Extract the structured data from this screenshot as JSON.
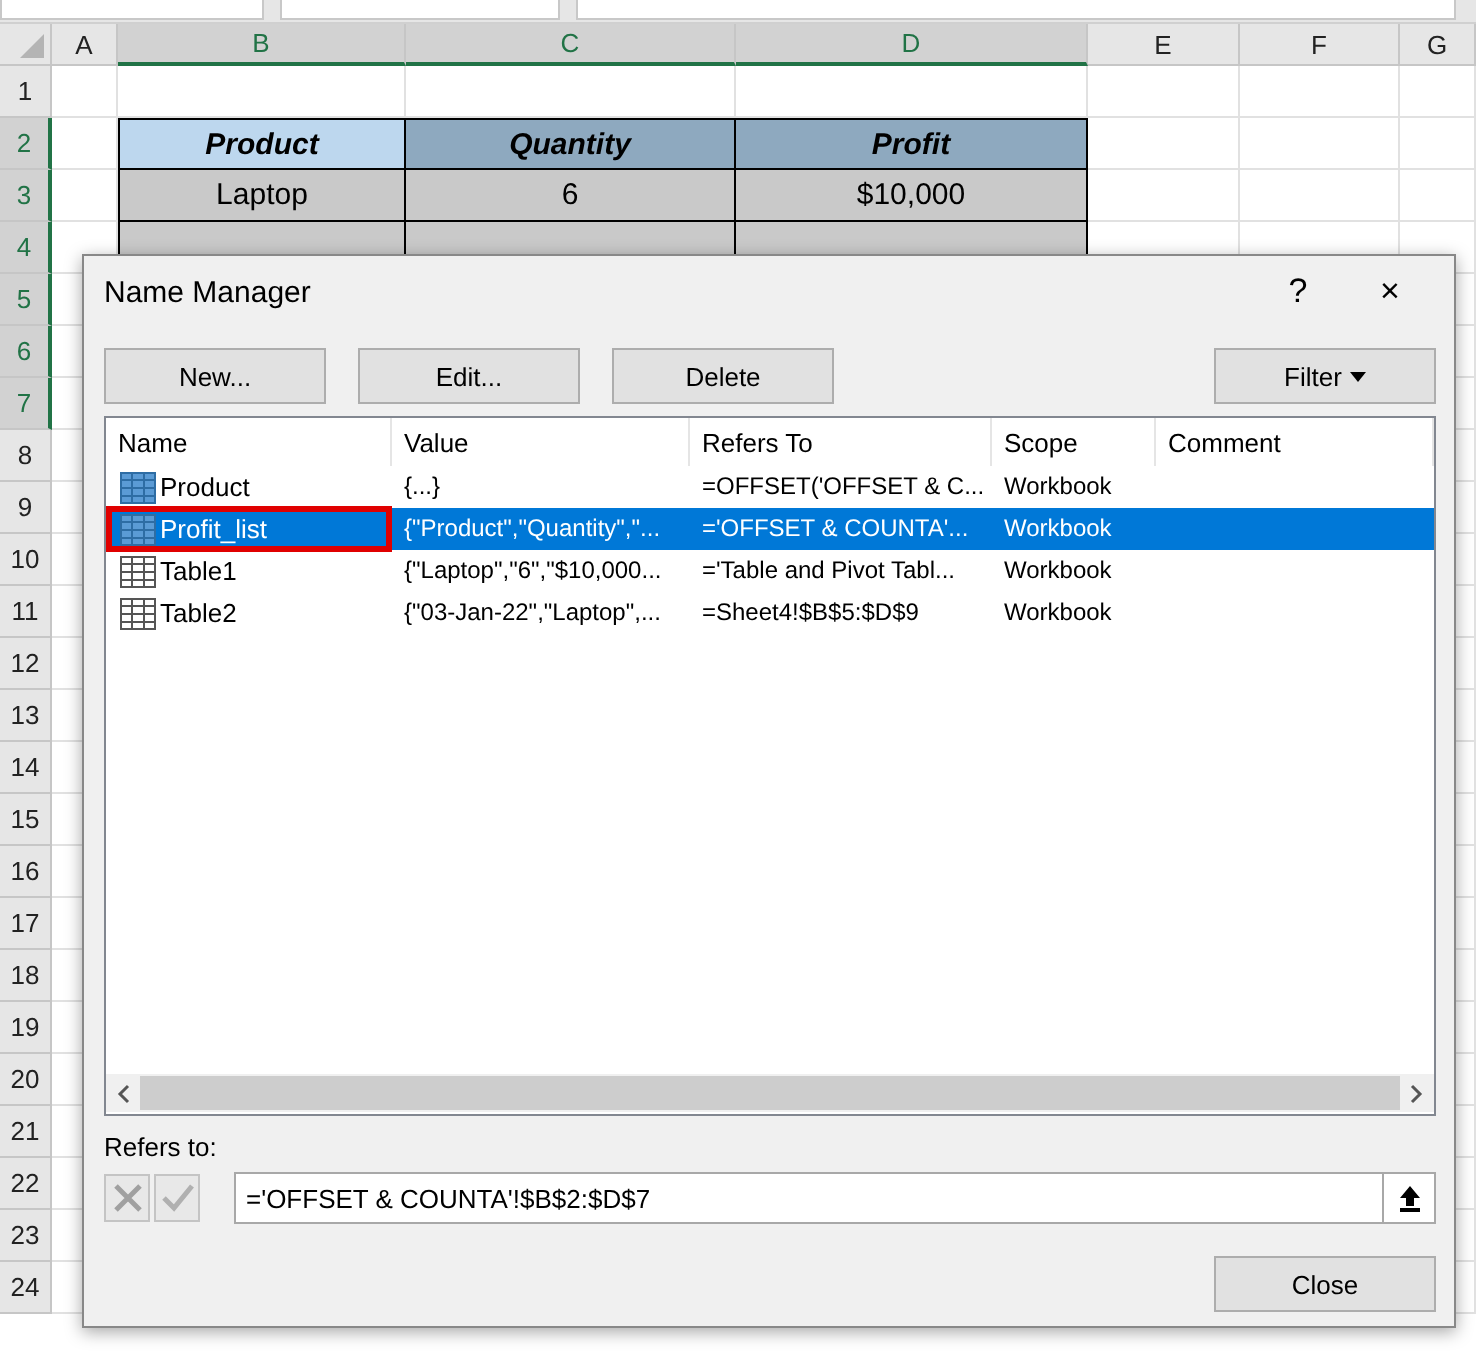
{
  "sheet": {
    "columns": [
      {
        "label": "A",
        "selected": false
      },
      {
        "label": "B",
        "selected": true
      },
      {
        "label": "C",
        "selected": true
      },
      {
        "label": "D",
        "selected": true
      },
      {
        "label": "E",
        "selected": false
      },
      {
        "label": "F",
        "selected": false
      },
      {
        "label": "G",
        "selected": false
      }
    ],
    "rows": [
      {
        "label": "1",
        "selected": false
      },
      {
        "label": "2",
        "selected": true
      },
      {
        "label": "3",
        "selected": true
      },
      {
        "label": "4",
        "selected": true
      },
      {
        "label": "5",
        "selected": true
      },
      {
        "label": "6",
        "selected": true
      },
      {
        "label": "7",
        "selected": true
      },
      {
        "label": "8",
        "selected": false
      },
      {
        "label": "9",
        "selected": false
      },
      {
        "label": "10",
        "selected": false
      },
      {
        "label": "11",
        "selected": false
      },
      {
        "label": "12",
        "selected": false
      },
      {
        "label": "13",
        "selected": false
      },
      {
        "label": "14",
        "selected": false
      },
      {
        "label": "15",
        "selected": false
      },
      {
        "label": "16",
        "selected": false
      },
      {
        "label": "17",
        "selected": false
      },
      {
        "label": "18",
        "selected": false
      },
      {
        "label": "19",
        "selected": false
      },
      {
        "label": "20",
        "selected": false
      },
      {
        "label": "21",
        "selected": false
      },
      {
        "label": "22",
        "selected": false
      },
      {
        "label": "23",
        "selected": false
      },
      {
        "label": "24",
        "selected": false
      }
    ],
    "table": {
      "header": [
        {
          "text": "Product",
          "active": true
        },
        {
          "text": "Quantity",
          "active": false
        },
        {
          "text": "Profit",
          "active": false
        }
      ],
      "rows": [
        [
          "Laptop",
          "6",
          "$10,000"
        ]
      ]
    }
  },
  "dialog": {
    "title": "Name Manager",
    "help": "?",
    "close": "×",
    "buttons": [
      {
        "label": "New...",
        "disabled": false
      },
      {
        "label": "Edit...",
        "disabled": false
      },
      {
        "label": "Delete",
        "disabled": false
      }
    ],
    "filter": "Filter",
    "columns": [
      "Name",
      "Value",
      "Refers To",
      "Scope",
      "Comment"
    ],
    "names": [
      {
        "kind": "range",
        "name": "Product",
        "value": "{...}",
        "refers_to": "=OFFSET('OFFSET & C...",
        "scope": "Workbook",
        "selected": false,
        "outlined": false
      },
      {
        "kind": "range",
        "name": "Profit_list",
        "value": "{\"Product\",\"Quantity\",\"...",
        "refers_to": "='OFFSET & COUNTA'...",
        "scope": "Workbook",
        "selected": true,
        "outlined": true
      },
      {
        "kind": "table",
        "name": "Table1",
        "value": "{\"Laptop\",\"6\",\"$10,000...",
        "refers_to": "='Table and Pivot Tabl...",
        "scope": "Workbook",
        "selected": false,
        "outlined": false
      },
      {
        "kind": "table",
        "name": "Table2",
        "value": "{\"03-Jan-22\",\"Laptop\",...",
        "refers_to": "=Sheet4!$B$5:$D$9",
        "scope": "Workbook",
        "selected": false,
        "outlined": false
      }
    ],
    "refers_to_label": "Refers to:",
    "refers_to_value": "='OFFSET & COUNTA'!$B$2:$D$7",
    "close_button": "Close"
  }
}
